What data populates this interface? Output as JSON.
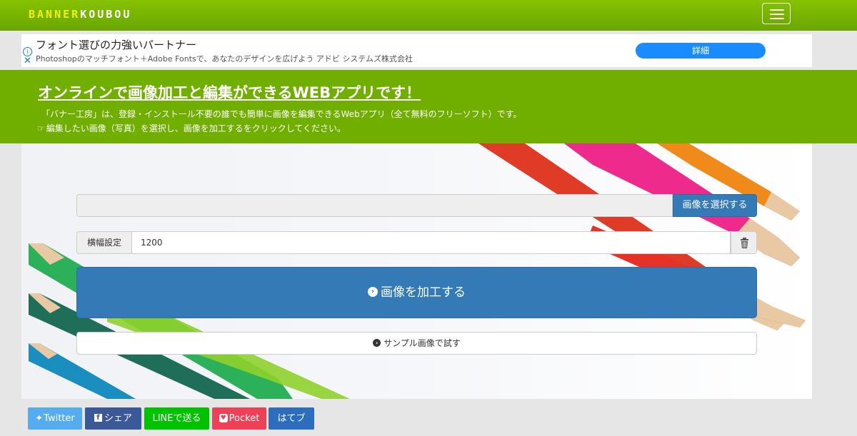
{
  "header": {
    "logo_part1": "BANNER",
    "logo_part2": "KOUBOU",
    "menu_icon": "hamburger-icon"
  },
  "ad": {
    "title": "フォント選びの力強いパートナー",
    "subtitle": "Photoshopのマッチフォント＋Adobe Fontsで、あなたのデザインを広げよう アドビ システムズ株式会社",
    "button_label": "詳細",
    "info_icon": "i",
    "close_icon": "✕"
  },
  "hero": {
    "title": "オンラインで画像加工と編集ができるWEBアプリです！",
    "desc1": "「バナー工房」は、登録・インストール不要の誰でも簡単に画像を編集できるWebアプリ（全て無料のフリーソフト）です。",
    "desc2": "編集したい画像（写真）を選択し、画像を加工するをクリックしてください。",
    "hand_icon": "☞"
  },
  "form": {
    "file_value": "",
    "select_button": "画像を選択する",
    "width_label": "横幅設定",
    "width_value": "1200",
    "process_button": "画像を加工する",
    "sample_button": "サンプル画像で試す"
  },
  "share": {
    "twitter": "Twitter",
    "facebook": "シェア",
    "line": "LINEで送る",
    "pocket": "Pocket",
    "hatena": "はてブ"
  },
  "colors": {
    "nav_green": "#70ae00",
    "primary_blue": "#337ab7",
    "logo_yellow": "#f5f000"
  }
}
